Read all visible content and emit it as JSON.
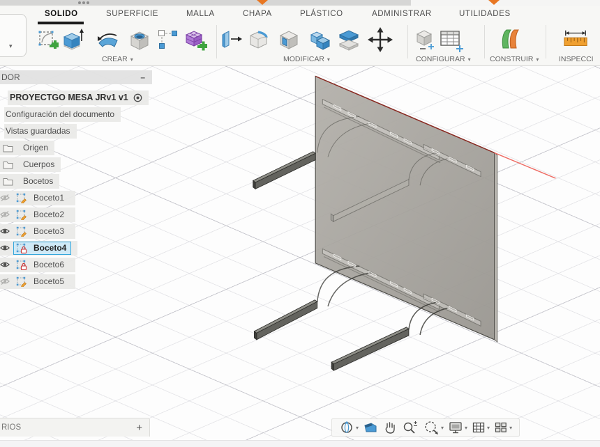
{
  "tabs": [
    {
      "label": "SOLIDO",
      "active": true
    },
    {
      "label": "SUPERFICIE",
      "active": false
    },
    {
      "label": "MALLA",
      "active": false
    },
    {
      "label": "CHAPA",
      "active": false
    },
    {
      "label": "PLÁSTICO",
      "active": false
    },
    {
      "label": "ADMINISTRAR",
      "active": false
    },
    {
      "label": "UTILIDADES",
      "active": false
    }
  ],
  "ribbon": {
    "groups": [
      {
        "label": "CREAR",
        "caret": "▾"
      },
      {
        "label": "MODIFICAR",
        "caret": "▾"
      },
      {
        "label": "CONFIGURAR",
        "caret": "▾"
      },
      {
        "label": "CONSTRUIR",
        "caret": "▾"
      },
      {
        "label": "INSPECCI",
        "caret": ""
      }
    ],
    "tools": [
      "create-sketch",
      "extrude",
      "revolve",
      "hole",
      "rectangular-pattern",
      "create-mesh",
      "press-pull",
      "fillet",
      "shell",
      "combine",
      "offset-face",
      "move-copy",
      "change-parameters",
      "configuration-table",
      "construct-plane",
      "measure"
    ],
    "overflow_caret": "▾"
  },
  "browser": {
    "header": {
      "title": "DOR",
      "collapse": "–"
    },
    "document": {
      "label": "PROYECTGO MESA JRv1 v1"
    },
    "items": [
      {
        "label": "Configuración del documento"
      },
      {
        "label": "Vistas guardadas"
      }
    ],
    "folders": [
      {
        "label": "Origen"
      },
      {
        "label": "Cuerpos"
      },
      {
        "label": "Bocetos"
      }
    ],
    "sketches": [
      {
        "label": "Boceto1",
        "visible": false,
        "locked": false,
        "selected": false
      },
      {
        "label": "Boceto2",
        "visible": false,
        "locked": false,
        "selected": false
      },
      {
        "label": "Boceto3",
        "visible": true,
        "locked": false,
        "selected": false
      },
      {
        "label": "Boceto4",
        "visible": true,
        "locked": true,
        "selected": true
      },
      {
        "label": "Boceto6",
        "visible": true,
        "locked": true,
        "selected": false
      },
      {
        "label": "Boceto5",
        "visible": false,
        "locked": false,
        "selected": false
      }
    ]
  },
  "navbar": {
    "icons": [
      "orbit",
      "look-at",
      "pan",
      "zoom",
      "fit",
      "display-settings",
      "grid-settings",
      "viewports"
    ],
    "caret": "▾"
  },
  "comments_panel": {
    "label": "RIOS",
    "add_button": "+"
  },
  "colors": {
    "accent_blue": "#4a9ad4",
    "selection_blue": "#35a7dc",
    "axis_red_bright": "#ee6c64",
    "axis_red_dark": "#8b2a22",
    "mesh_purple": "#a86fd0",
    "construct_green": "#5fb560",
    "construct_orange": "#e8833a",
    "measure_orange": "#f0a030",
    "panel_gray": "#a09d97"
  }
}
